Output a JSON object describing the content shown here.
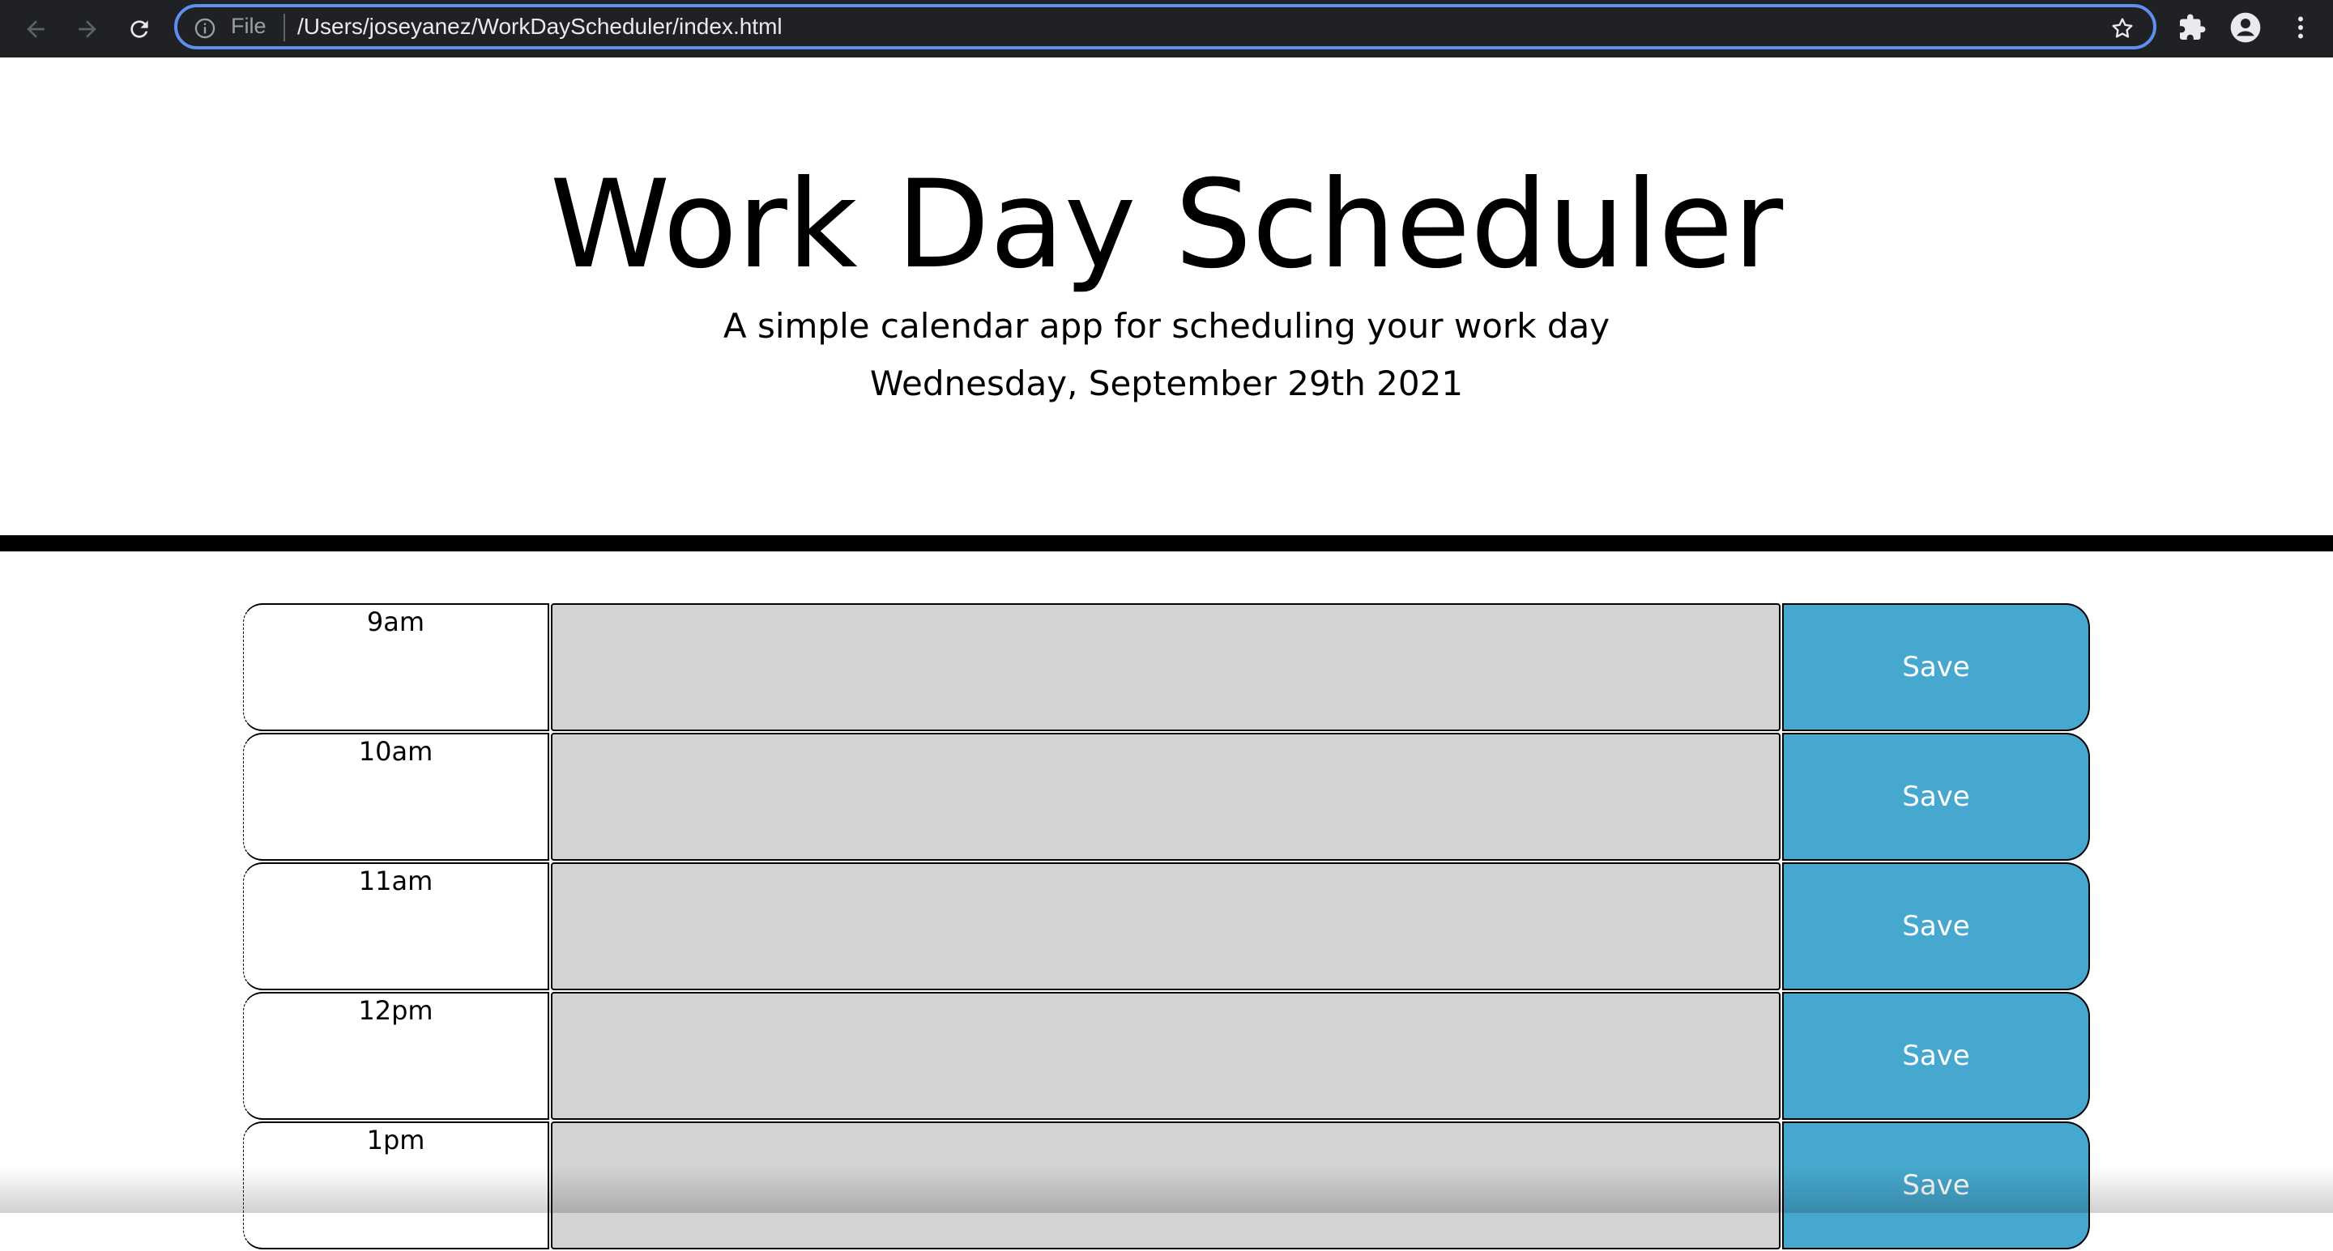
{
  "browser": {
    "scheme_label": "File",
    "url": "/Users/joseyanez/WorkDayScheduler/index.html"
  },
  "header": {
    "title": "Work Day Scheduler",
    "lead": "A simple calendar app for scheduling your work day",
    "date": "Wednesday, September 29th 2021"
  },
  "rows": [
    {
      "hour": "9am",
      "save_label": "Save"
    },
    {
      "hour": "10am",
      "save_label": "Save"
    },
    {
      "hour": "11am",
      "save_label": "Save"
    },
    {
      "hour": "12pm",
      "save_label": "Save"
    },
    {
      "hour": "1pm",
      "save_label": "Save"
    }
  ],
  "colors": {
    "description_background": "#d3d3d3",
    "save_button": "#46a8ce",
    "omnibox_focus": "#5f8ff0"
  }
}
